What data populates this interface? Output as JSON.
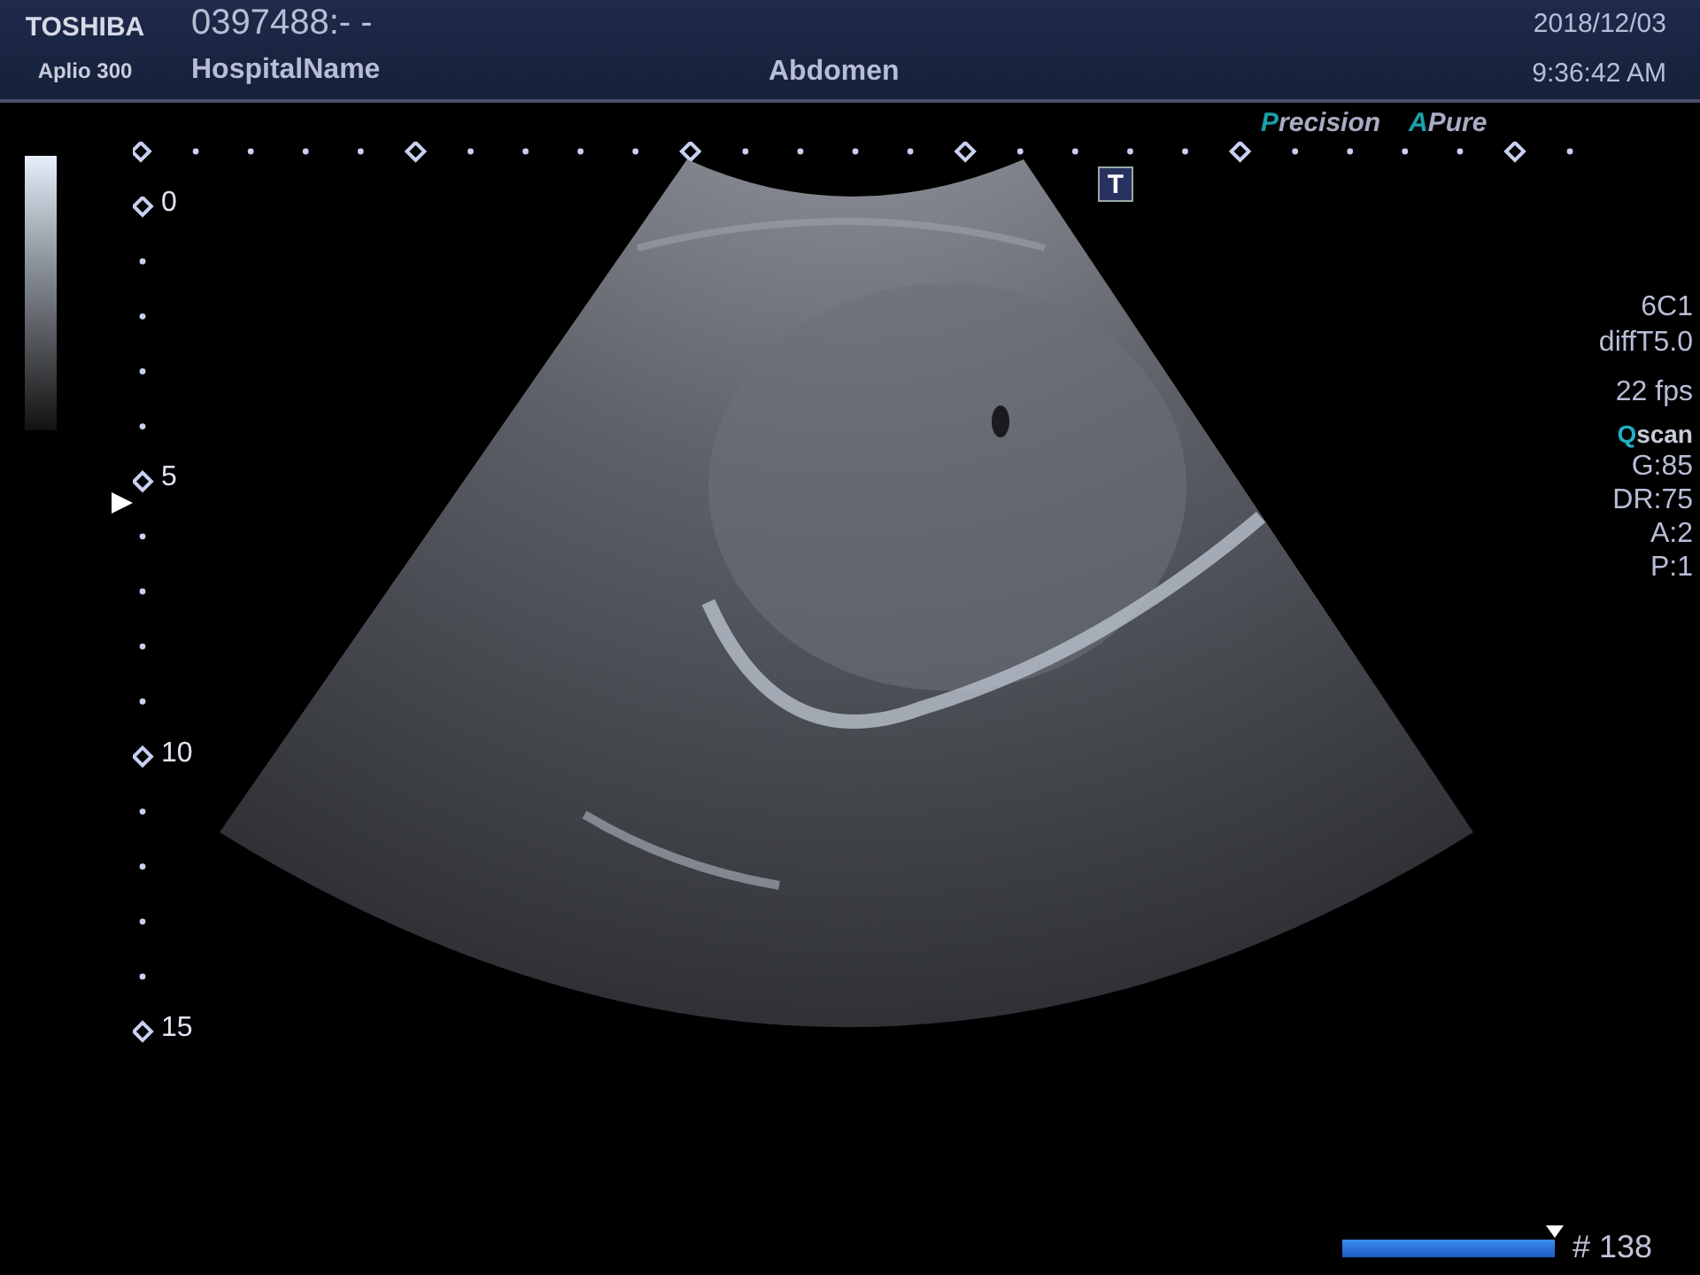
{
  "header": {
    "brand": "TOSHIBA",
    "model": "Aplio 300",
    "patient_id": "0397488:- -",
    "hospital": "HospitalName",
    "exam": "Abdomen",
    "date": "2018/12/03",
    "time": "9:36:42 AM"
  },
  "modes": [
    {
      "accent": "P",
      "rest": "recision"
    },
    {
      "accent": "A",
      "rest": "Pure"
    }
  ],
  "badge": "T",
  "depth_scale": [
    "0",
    "5",
    "10",
    "15"
  ],
  "probe_info": [
    "6C1",
    "diffT5.0"
  ],
  "frame_rate": "22 fps",
  "qscan": {
    "accent": "Q",
    "rest": "scan"
  },
  "params": [
    "G:85",
    "DR:75",
    "A:2",
    "P:1"
  ],
  "cine": {
    "level": 1,
    "frame": "# 138"
  }
}
